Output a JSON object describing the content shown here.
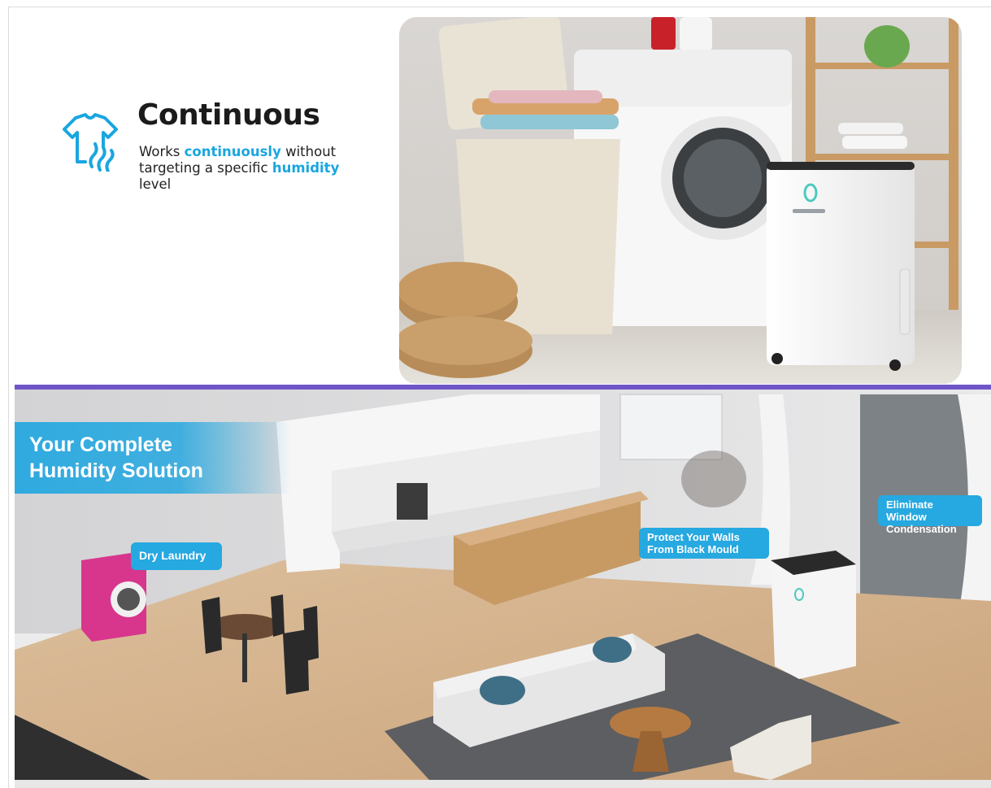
{
  "top": {
    "title": "Continuous",
    "desc_1": "Works ",
    "desc_2": "continuously",
    "desc_3": " without targeting a specific ",
    "desc_4": "humidity",
    "desc_5": " level"
  },
  "bottom": {
    "headline_line1": "Your Complete",
    "headline_line2": "Humidity Solution",
    "callout_laundry": "Dry Laundry",
    "callout_mould": "Protect Your Walls From Black Mould",
    "callout_condensation": "Eliminate Window Condensation"
  },
  "colors": {
    "accent": "#26a8e0",
    "divider": "#6e55c8",
    "title": "#1b1b1b"
  },
  "icons": {
    "feature": "tshirt-steam-icon",
    "brand": "dehumidifier-logo"
  }
}
